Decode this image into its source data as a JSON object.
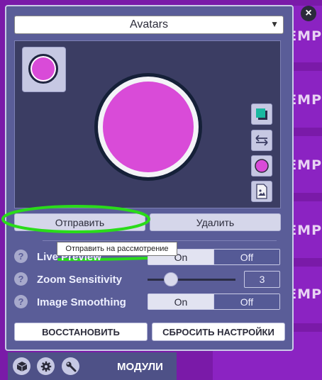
{
  "panel": {
    "close_icon": "×",
    "dropdown_value": "Avatars"
  },
  "avatar": {
    "fill_color": "#d94bd8",
    "ring_color": "#152038"
  },
  "tools": [
    {
      "name": "color-swatch-icon"
    },
    {
      "name": "swap-arrows-icon"
    },
    {
      "name": "circle-shape-icon"
    },
    {
      "name": "image-file-icon"
    }
  ],
  "actions": {
    "submit": "Отправить",
    "delete": "Удалить"
  },
  "tooltip": "Отправить на рассмотрение",
  "settings": {
    "live_preview": {
      "label": "Live Preview",
      "on": "On",
      "off": "Off",
      "selected": "On"
    },
    "zoom": {
      "label": "Zoom Sensitivity",
      "value": "3"
    },
    "smoothing": {
      "label": "Image Smoothing",
      "on": "On",
      "off": "Off",
      "selected": "On"
    }
  },
  "footer_buttons": {
    "restore": "ВОССТАНОВИТЬ",
    "reset": "СБРОСИТЬ НАСТРОЙКИ"
  },
  "bottom_bar": {
    "modules_label": "МОДУЛИ",
    "icons": [
      "cube-icon",
      "gear-icon",
      "wrench-icon"
    ]
  },
  "background": {
    "empty_label": "EMP"
  },
  "annotation_color": "#2adb1a"
}
